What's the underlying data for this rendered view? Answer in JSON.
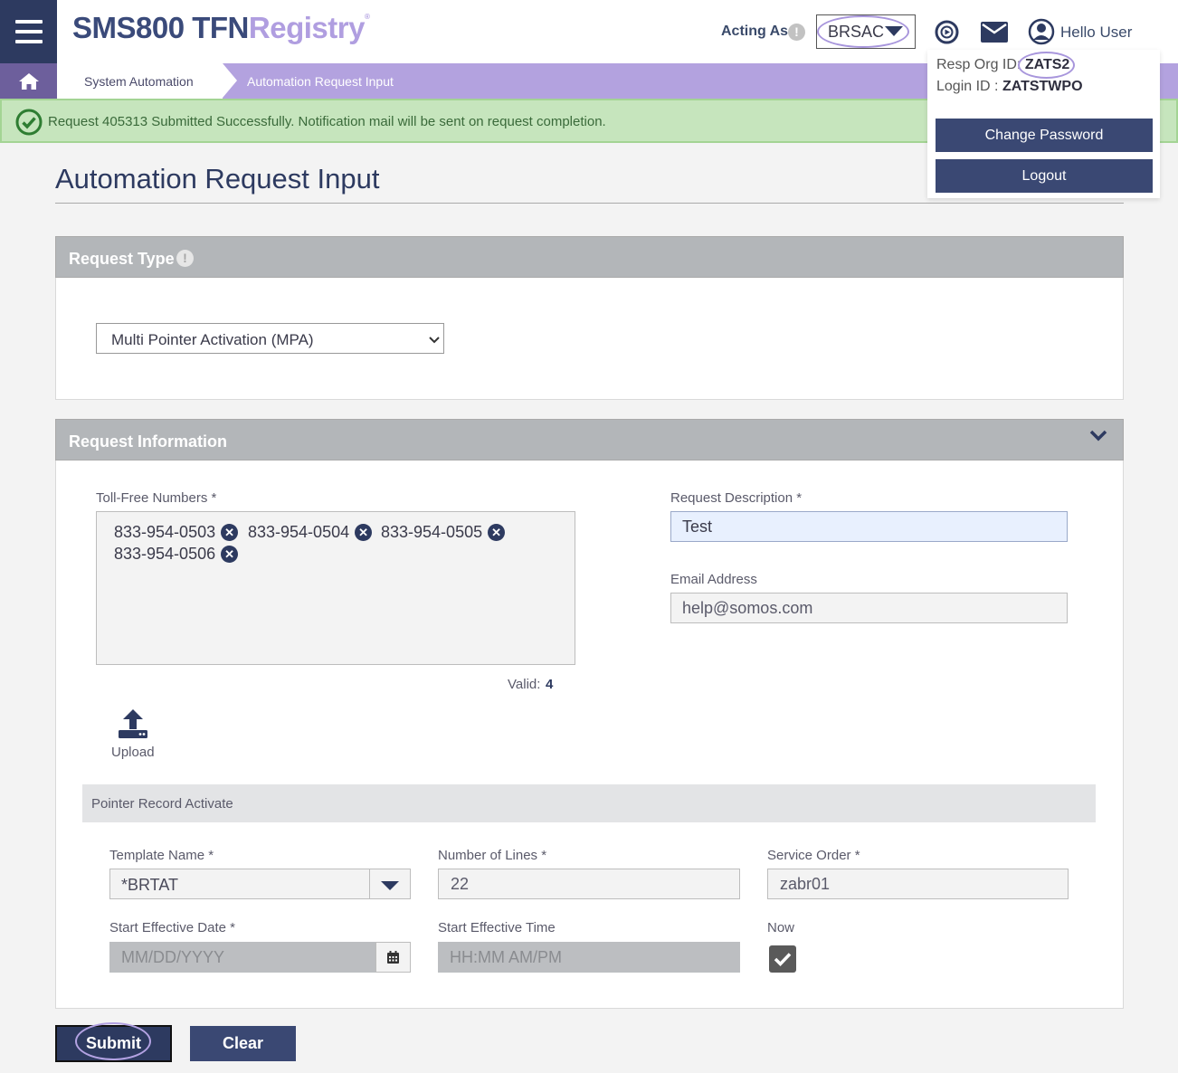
{
  "header": {
    "logo_part1": "SMS800 TFN",
    "logo_part2": "Registry",
    "logo_mark": "®",
    "acting_as_label": "Acting As",
    "info_glyph": "!",
    "acting_as_value": "BRSAC",
    "greeting": "Hello User",
    "icons": [
      "menu-icon",
      "play-circle-icon",
      "mail-icon",
      "user-circle-icon",
      "home-icon"
    ]
  },
  "user_panel": {
    "resp_org_label": "Resp Org ID:",
    "resp_org_value": "ZATS2",
    "login_label": "Login ID :",
    "login_value": "ZATSTWPO",
    "change_password": "Change Password",
    "logout": "Logout"
  },
  "breadcrumb": {
    "items": [
      "System Automation",
      "Automation Request Input"
    ]
  },
  "banner": {
    "message": "Request 405313 Submitted Successfully. Notification mail will be sent on request completion."
  },
  "page": {
    "title": "Automation Request Input"
  },
  "request_type": {
    "heading": "Request Type",
    "selected": "Multi Pointer Activation (MPA)"
  },
  "request_info": {
    "heading": "Request Information",
    "tfn_label": "Toll-Free Numbers *",
    "tfns": [
      "833-954-0503",
      "833-954-0504",
      "833-954-0505",
      "833-954-0506"
    ],
    "valid_label": "Valid:",
    "valid_count": "4",
    "upload_label": "Upload",
    "desc_label": "Request Description *",
    "desc_value": "Test",
    "email_label": "Email Address",
    "email_value": "help@somos.com"
  },
  "pointer_record": {
    "heading": "Pointer Record Activate",
    "template_label": "Template Name *",
    "template_value": "*BRTAT",
    "lines_label": "Number of Lines *",
    "lines_value": "22",
    "service_order_label": "Service Order *",
    "service_order_value": "zabr01",
    "start_date_label": "Start Effective Date *",
    "start_date_placeholder": "MM/DD/YYYY",
    "start_time_label": "Start Effective Time",
    "start_time_placeholder": "HH:MM AM/PM",
    "now_label": "Now",
    "now_checked": true
  },
  "actions": {
    "submit": "Submit",
    "clear": "Clear"
  },
  "colors": {
    "navy": "#2d3a60",
    "button": "#3a4873",
    "lavender": "#b3a2df",
    "success_bg": "#c6e5bd",
    "success_icon": "#2e7d32",
    "panel_header": "#b3b6b9"
  }
}
